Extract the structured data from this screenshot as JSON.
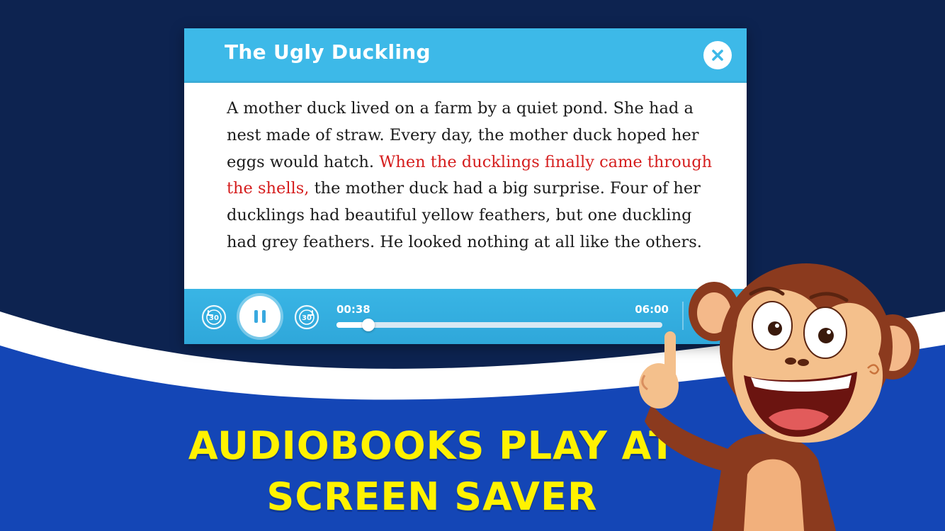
{
  "reader": {
    "title": "The Ugly Duckling",
    "story": {
      "before": "A mother duck lived on a farm by a quiet pond. She had a nest made of straw. Every day, the mother duck hoped her eggs would hatch. ",
      "highlight": "When the ducklings finally came through the shells,",
      "after": " the mother duck had a big surprise. Four of her ducklings had beautiful yellow feathers, but one duckling had grey feathers. He looked nothing at all like the others."
    }
  },
  "player": {
    "current_time": "00:38",
    "total_time": "06:00",
    "progress": 0.097,
    "skip_back_label": "30",
    "skip_forward_label": "30"
  },
  "banner": {
    "line1": "AUDIOBOOKS PLAY AT",
    "line2": "SCREEN SAVER"
  },
  "colors": {
    "background_top": "#0d2350",
    "background_bottom": "#1446b6",
    "header": "#3db9e8",
    "highlight_text": "#d51d1d",
    "caption": "#fff200"
  },
  "icons": {
    "close": "close-icon",
    "pause": "pause-icon",
    "skip_back": "rewind-30-icon",
    "skip_forward": "forward-30-icon"
  }
}
